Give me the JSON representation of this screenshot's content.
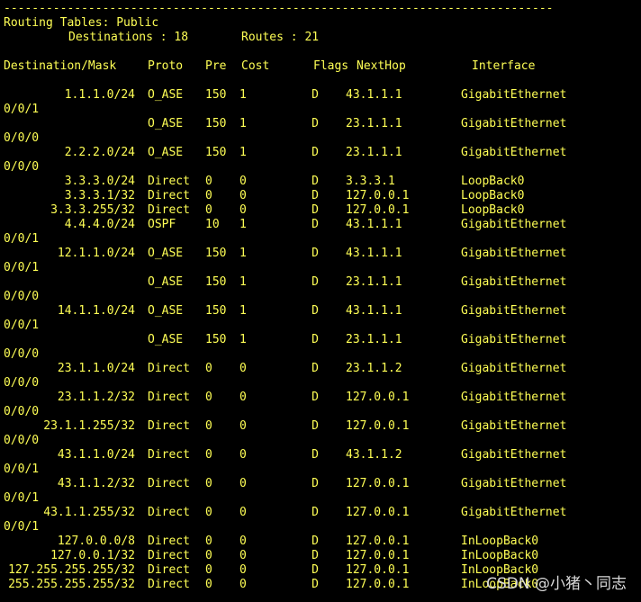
{
  "terminal": {
    "separator": "------------------------------------------------------------------------------",
    "title": "Routing Tables: Public",
    "summary": {
      "destinations_label": "Destinations : 18",
      "routes_label": "Routes : 21"
    },
    "columns": [
      "Destination/Mask",
      "Proto",
      "Pre",
      "Cost",
      "Flags",
      "NextHop",
      "Interface"
    ],
    "rows": [
      {
        "dest": "1.1.1.0/24",
        "proto": "O_ASE",
        "pre": "150",
        "cost": "1",
        "flags": "D",
        "nexthop": "43.1.1.1",
        "iface": "GigabitEthernet",
        "wrap": "0/0/1"
      },
      {
        "dest": "",
        "proto": "O_ASE",
        "pre": "150",
        "cost": "1",
        "flags": "D",
        "nexthop": "23.1.1.1",
        "iface": "GigabitEthernet",
        "wrap": "0/0/0"
      },
      {
        "dest": "2.2.2.0/24",
        "proto": "O_ASE",
        "pre": "150",
        "cost": "1",
        "flags": "D",
        "nexthop": "23.1.1.1",
        "iface": "GigabitEthernet",
        "wrap": "0/0/0"
      },
      {
        "dest": "3.3.3.0/24",
        "proto": "Direct",
        "pre": "0",
        "cost": "0",
        "flags": "D",
        "nexthop": "3.3.3.1",
        "iface": "LoopBack0",
        "wrap": ""
      },
      {
        "dest": "3.3.3.1/32",
        "proto": "Direct",
        "pre": "0",
        "cost": "0",
        "flags": "D",
        "nexthop": "127.0.0.1",
        "iface": "LoopBack0",
        "wrap": ""
      },
      {
        "dest": "3.3.3.255/32",
        "proto": "Direct",
        "pre": "0",
        "cost": "0",
        "flags": "D",
        "nexthop": "127.0.0.1",
        "iface": "LoopBack0",
        "wrap": ""
      },
      {
        "dest": "4.4.4.0/24",
        "proto": "OSPF",
        "pre": "10",
        "cost": "1",
        "flags": "D",
        "nexthop": "43.1.1.1",
        "iface": "GigabitEthernet",
        "wrap": "0/0/1"
      },
      {
        "dest": "12.1.1.0/24",
        "proto": "O_ASE",
        "pre": "150",
        "cost": "1",
        "flags": "D",
        "nexthop": "43.1.1.1",
        "iface": "GigabitEthernet",
        "wrap": "0/0/1"
      },
      {
        "dest": "",
        "proto": "O_ASE",
        "pre": "150",
        "cost": "1",
        "flags": "D",
        "nexthop": "23.1.1.1",
        "iface": "GigabitEthernet",
        "wrap": "0/0/0"
      },
      {
        "dest": "14.1.1.0/24",
        "proto": "O_ASE",
        "pre": "150",
        "cost": "1",
        "flags": "D",
        "nexthop": "43.1.1.1",
        "iface": "GigabitEthernet",
        "wrap": "0/0/1"
      },
      {
        "dest": "",
        "proto": "O_ASE",
        "pre": "150",
        "cost": "1",
        "flags": "D",
        "nexthop": "23.1.1.1",
        "iface": "GigabitEthernet",
        "wrap": "0/0/0"
      },
      {
        "dest": "23.1.1.0/24",
        "proto": "Direct",
        "pre": "0",
        "cost": "0",
        "flags": "D",
        "nexthop": "23.1.1.2",
        "iface": "GigabitEthernet",
        "wrap": "0/0/0"
      },
      {
        "dest": "23.1.1.2/32",
        "proto": "Direct",
        "pre": "0",
        "cost": "0",
        "flags": "D",
        "nexthop": "127.0.0.1",
        "iface": "GigabitEthernet",
        "wrap": "0/0/0"
      },
      {
        "dest": "23.1.1.255/32",
        "proto": "Direct",
        "pre": "0",
        "cost": "0",
        "flags": "D",
        "nexthop": "127.0.0.1",
        "iface": "GigabitEthernet",
        "wrap": "0/0/0"
      },
      {
        "dest": "43.1.1.0/24",
        "proto": "Direct",
        "pre": "0",
        "cost": "0",
        "flags": "D",
        "nexthop": "43.1.1.2",
        "iface": "GigabitEthernet",
        "wrap": "0/0/1"
      },
      {
        "dest": "43.1.1.2/32",
        "proto": "Direct",
        "pre": "0",
        "cost": "0",
        "flags": "D",
        "nexthop": "127.0.0.1",
        "iface": "GigabitEthernet",
        "wrap": "0/0/1"
      },
      {
        "dest": "43.1.1.255/32",
        "proto": "Direct",
        "pre": "0",
        "cost": "0",
        "flags": "D",
        "nexthop": "127.0.0.1",
        "iface": "GigabitEthernet",
        "wrap": "0/0/1"
      },
      {
        "dest": "127.0.0.0/8",
        "proto": "Direct",
        "pre": "0",
        "cost": "0",
        "flags": "D",
        "nexthop": "127.0.0.1",
        "iface": "InLoopBack0",
        "wrap": ""
      },
      {
        "dest": "127.0.0.1/32",
        "proto": "Direct",
        "pre": "0",
        "cost": "0",
        "flags": "D",
        "nexthop": "127.0.0.1",
        "iface": "InLoopBack0",
        "wrap": ""
      },
      {
        "dest": "127.255.255.255/32",
        "proto": "Direct",
        "pre": "0",
        "cost": "0",
        "flags": "D",
        "nexthop": "127.0.0.1",
        "iface": "InLoopBack0",
        "wrap": ""
      },
      {
        "dest": "255.255.255.255/32",
        "proto": "Direct",
        "pre": "0",
        "cost": "0",
        "flags": "D",
        "nexthop": "127.0.0.1",
        "iface": "InLoopBack0",
        "wrap": ""
      }
    ]
  },
  "watermark": "CSDN @小猪丶同志",
  "colors": {
    "background": "#000000",
    "text": "#ffff55",
    "watermark": "#d9d9d9"
  }
}
